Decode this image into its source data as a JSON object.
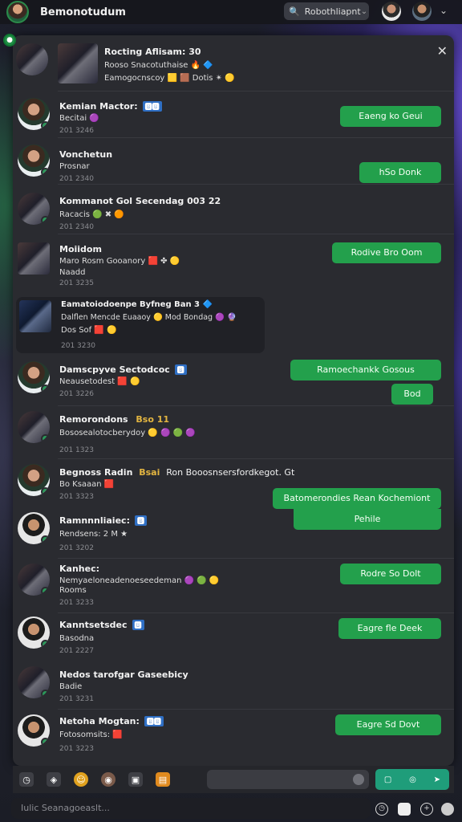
{
  "topbar": {
    "title": "Bemonotudum",
    "search_text": "Robothliapnt",
    "search_icon": "search-icon",
    "chevron": "⌄"
  },
  "panel": {
    "close_icon": "close-icon",
    "close_glyph": "✕"
  },
  "messages": [
    {
      "name": "Rocting Aflisam: 30",
      "line2": "Rooso Snacotuthaise 🔥 🔷",
      "line3": "Eamogocnscoy 🟨 🟫 Dotis ✴ 🟡"
    },
    {
      "name": "Kemian Mactor:",
      "badge": "🅱🅱",
      "line2": "Becitai 🟣",
      "ts": "201 3246",
      "button": "Eaeng ko Geui"
    },
    {
      "name": "Vonchetun",
      "line2": "Prosnar",
      "ts": "201 2340",
      "button": "hSo Donk"
    },
    {
      "name": "Kommanot Gol Secendag 003 22",
      "line2": "Racacis 🟢 ✖ 🟠",
      "ts": "201 2340"
    },
    {
      "name": "Moiidom",
      "line2": "Maro Rosm Gooanory 🟥 ✤ 🟡",
      "line3": "Naadd",
      "ts": "201 3235",
      "button": "Rodive Bro Oom"
    },
    {
      "name": "Eamatoiodoenpe Byfneg Ban 3 🔷",
      "line2": "Dalflen Mencde Euaaoy 🟡 Mod Bondag 🟣 🔮",
      "line3": "Dos Sof 🟥 🟡",
      "ts": "201 3230"
    },
    {
      "name": "Damscpyve Sectodcoc",
      "badge": "🅱",
      "line2": "Neausetodest 🟥 🟡",
      "ts": "201 3226",
      "button": "Ramoechankk Gosous",
      "button2": "Bod"
    },
    {
      "name": "Remorondons",
      "tag": "Bso 11",
      "line2": "Bososealotocberydoy 🟡 🟣 🟢 🟣",
      "ts": "201 1323"
    },
    {
      "name": "Begnoss Radin",
      "tag": "Bsai",
      "name_rest": "Ron Booosnsersfordkegot. Gt",
      "line2": "Bo Ksaaan 🟥",
      "ts": "201 3323",
      "button": "Batomerondies Rean Kochemiont",
      "button2": "Pehile"
    },
    {
      "name": "Ramnnnliaiec:",
      "badge": "🅱",
      "line2": "Rendsens: 2 M ★",
      "ts": "201 3202"
    },
    {
      "name": "Kanhec:",
      "line2": "Nemyaeloneadenoeseedeman 🟣 🟢 🟡",
      "line3": "Rooms",
      "ts": "201 3233",
      "button": "Rodre So Dolt"
    },
    {
      "name": "Kanntsetsdec",
      "badge": "🅱",
      "line2": "Basodna",
      "ts": "201 2227",
      "button": "Eagre fle Deek"
    },
    {
      "name": "Nedos tarofgar Gaseebicy",
      "line2": "Badie",
      "ts": "201 3231"
    },
    {
      "name": "Netoha Mogtan:",
      "badge": "🅱🅱",
      "line2": "Fotosomsits: 🟥",
      "ts": "201 3223",
      "button": "Eagre Sd Dovt"
    }
  ],
  "compose": {
    "icons": [
      "timer-icon",
      "shield-icon",
      "emoji-icon",
      "avatar-icon",
      "gift-icon",
      "sticker-icon"
    ],
    "send_icons": [
      "attach-icon",
      "camera-icon",
      "send-icon"
    ]
  },
  "bottombar": {
    "placeholder": "Iulic Seanagoeaslt..."
  },
  "bottom_icons": [
    "clock-icon",
    "heart-icon",
    "plus-icon",
    "settings-icon"
  ]
}
